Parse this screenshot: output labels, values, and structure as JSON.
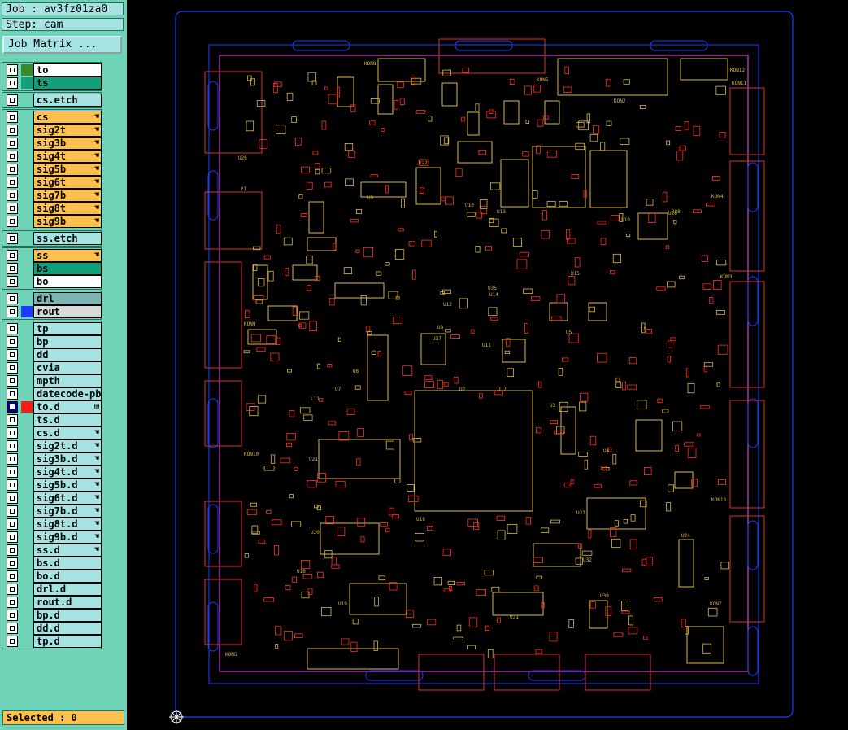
{
  "job": {
    "label": "Job : av3fz01za0"
  },
  "step": {
    "label": "Step: cam"
  },
  "matrix_button": {
    "label": "Job Matrix ..."
  },
  "layers": [
    {
      "name": "to",
      "bg": "#ffffff",
      "swatch": "#3a8a2a",
      "hand": ""
    },
    {
      "name": "ts",
      "bg": "#12a07a",
      "swatch": "#12a07a",
      "hand": ""
    },
    {
      "name": "cs.etch",
      "bg": "#a6e3e3",
      "swatch": "",
      "hand": ""
    },
    {
      "name": "cs",
      "bg": "#ffc14d",
      "swatch": "",
      "hand": "☚"
    },
    {
      "name": "sig2t",
      "bg": "#ffc14d",
      "swatch": "",
      "hand": "☚"
    },
    {
      "name": "sig3b",
      "bg": "#ffc14d",
      "swatch": "",
      "hand": "☚"
    },
    {
      "name": "sig4t",
      "bg": "#ffc14d",
      "swatch": "",
      "hand": "☚"
    },
    {
      "name": "sig5b",
      "bg": "#ffc14d",
      "swatch": "",
      "hand": "☚"
    },
    {
      "name": "sig6t",
      "bg": "#ffc14d",
      "swatch": "",
      "hand": "☚"
    },
    {
      "name": "sig7b",
      "bg": "#ffc14d",
      "swatch": "",
      "hand": "☚"
    },
    {
      "name": "sig8t",
      "bg": "#ffc14d",
      "swatch": "",
      "hand": "☚"
    },
    {
      "name": "sig9b",
      "bg": "#ffc14d",
      "swatch": "",
      "hand": "☚"
    },
    {
      "name": "ss.etch",
      "bg": "#a6e3e3",
      "swatch": "",
      "hand": ""
    },
    {
      "name": "ss",
      "bg": "#ffc14d",
      "swatch": "",
      "hand": "☚"
    },
    {
      "name": "bs",
      "bg": "#12a07a",
      "swatch": "",
      "hand": ""
    },
    {
      "name": "bo",
      "bg": "#ffffff",
      "swatch": "",
      "hand": ""
    },
    {
      "name": "drl",
      "bg": "#7fb4b4",
      "swatch": "",
      "hand": ""
    },
    {
      "name": "rout",
      "bg": "#d9d9d9",
      "swatch": "#1e3cff",
      "hand": ""
    },
    {
      "name": "tp",
      "bg": "#a6e3e3",
      "swatch": "",
      "hand": ""
    },
    {
      "name": "bp",
      "bg": "#a6e3e3",
      "swatch": "",
      "hand": ""
    },
    {
      "name": "dd",
      "bg": "#a6e3e3",
      "swatch": "",
      "hand": ""
    },
    {
      "name": "cvia",
      "bg": "#a6e3e3",
      "swatch": "",
      "hand": ""
    },
    {
      "name": "mpth",
      "bg": "#a6e3e3",
      "swatch": "",
      "hand": ""
    },
    {
      "name": "datecode-pbe",
      "bg": "#a6e3e3",
      "swatch": "",
      "hand": ""
    },
    {
      "name": "to.d",
      "bg": "#a6e3e3",
      "swatch": "#ff1a1a",
      "hand": "⊞",
      "checked": true
    },
    {
      "name": "ts.d",
      "bg": "#a6e3e3",
      "swatch": "",
      "hand": ""
    },
    {
      "name": "cs.d",
      "bg": "#a6e3e3",
      "swatch": "",
      "hand": "☚"
    },
    {
      "name": "sig2t.d",
      "bg": "#a6e3e3",
      "swatch": "",
      "hand": "☚"
    },
    {
      "name": "sig3b.d",
      "bg": "#a6e3e3",
      "swatch": "",
      "hand": "☚"
    },
    {
      "name": "sig4t.d",
      "bg": "#a6e3e3",
      "swatch": "",
      "hand": "☚"
    },
    {
      "name": "sig5b.d",
      "bg": "#a6e3e3",
      "swatch": "",
      "hand": "☚"
    },
    {
      "name": "sig6t.d",
      "bg": "#a6e3e3",
      "swatch": "",
      "hand": "☚"
    },
    {
      "name": "sig7b.d",
      "bg": "#a6e3e3",
      "swatch": "",
      "hand": "☚"
    },
    {
      "name": "sig8t.d",
      "bg": "#a6e3e3",
      "swatch": "",
      "hand": "☚"
    },
    {
      "name": "sig9b.d",
      "bg": "#a6e3e3",
      "swatch": "",
      "hand": "☚"
    },
    {
      "name": "ss.d",
      "bg": "#a6e3e3",
      "swatch": "",
      "hand": "☚"
    },
    {
      "name": "bs.d",
      "bg": "#a6e3e3",
      "swatch": "",
      "hand": ""
    },
    {
      "name": "bo.d",
      "bg": "#a6e3e3",
      "swatch": "",
      "hand": ""
    },
    {
      "name": "drl.d",
      "bg": "#a6e3e3",
      "swatch": "",
      "hand": ""
    },
    {
      "name": "rout.d",
      "bg": "#a6e3e3",
      "swatch": "",
      "hand": ""
    },
    {
      "name": "bp.d",
      "bg": "#a6e3e3",
      "swatch": "",
      "hand": ""
    },
    {
      "name": "dd.d",
      "bg": "#a6e3e3",
      "swatch": "",
      "hand": ""
    },
    {
      "name": "tp.d",
      "bg": "#a6e3e3",
      "swatch": "",
      "hand": ""
    }
  ],
  "status": {
    "label": "Selected : 0"
  },
  "board_labels": [
    "KON8",
    "KON5",
    "KON2",
    "KON12",
    "KON11",
    "KON4",
    "KON3",
    "KON9",
    "KON10",
    "KON6",
    "KON13",
    "KON7",
    "U24",
    "U2",
    "U3",
    "U4",
    "U5",
    "U6",
    "U7",
    "U8",
    "U9",
    "U10",
    "U11",
    "U12",
    "U13",
    "U14",
    "U15",
    "U16",
    "U17",
    "U18",
    "U19",
    "U20",
    "U21",
    "U22",
    "U23",
    "U30",
    "U31",
    "U32",
    "R88",
    "L9",
    "L10",
    "L11",
    "Y1",
    "U26",
    "U28",
    "U35",
    "U37"
  ],
  "colors": {
    "rout": "#1e3cff",
    "profile": "#d040d0",
    "component": "#d8b84a",
    "pad": "#ff3020",
    "connector": "#e03030"
  }
}
